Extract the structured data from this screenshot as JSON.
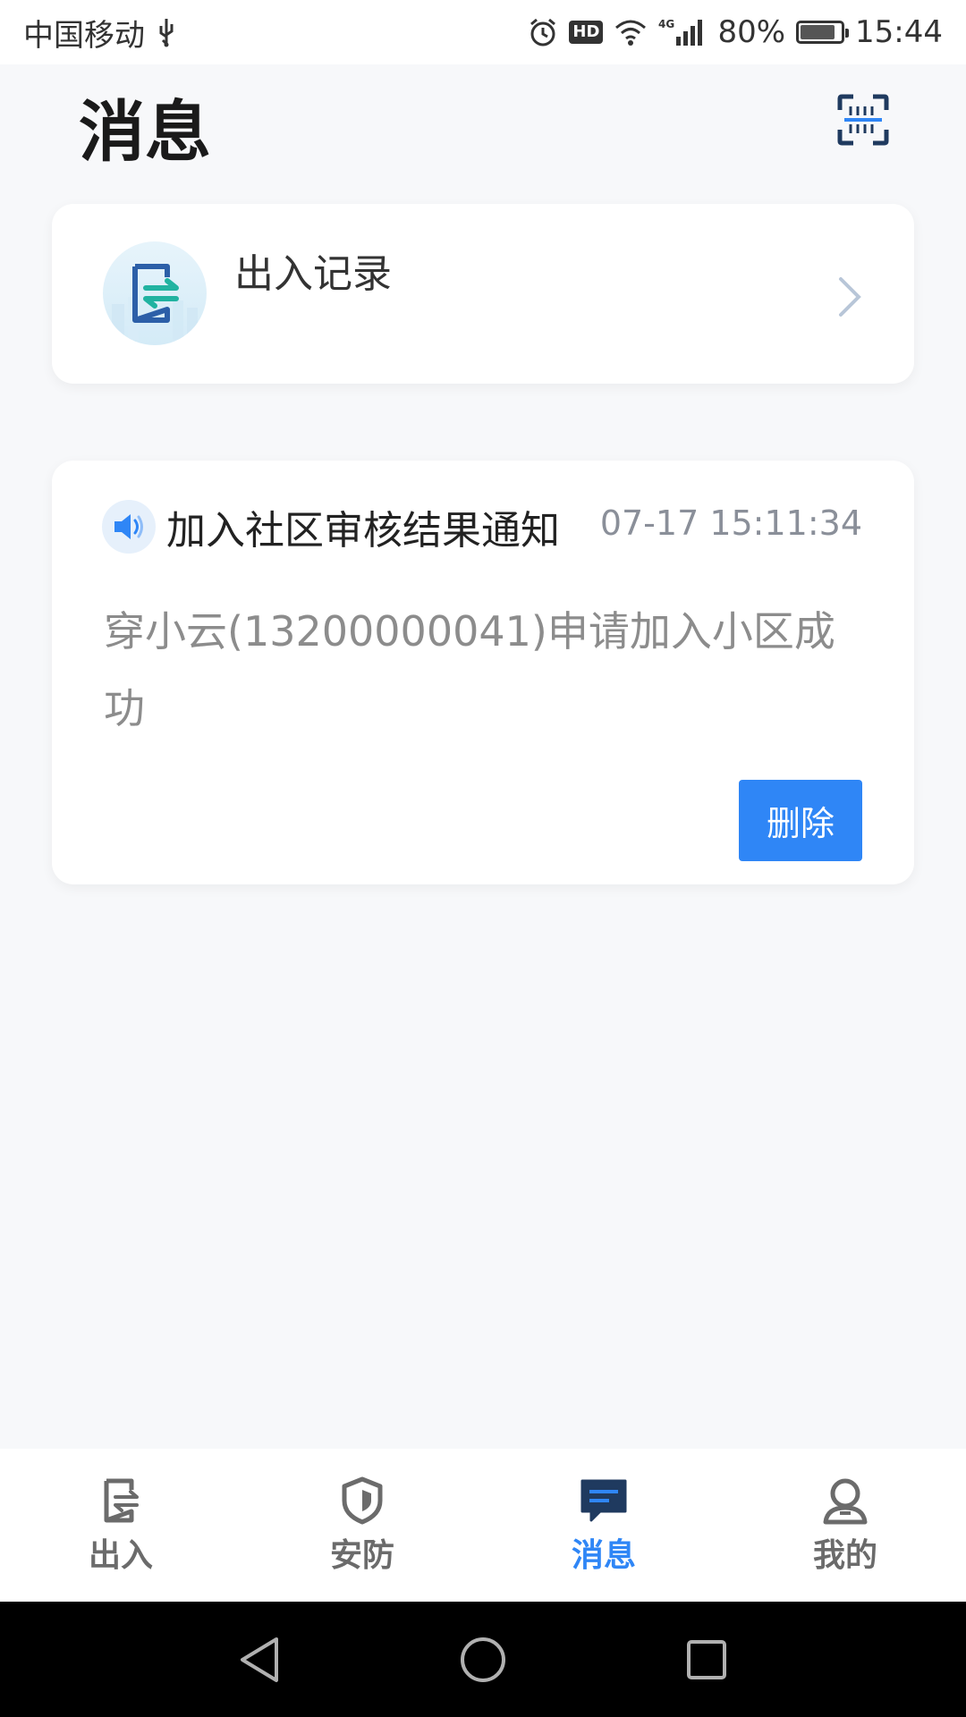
{
  "status_bar": {
    "carrier": "中国移动",
    "hd": "HD",
    "network": "4G",
    "battery": "80%",
    "time": "15:44"
  },
  "header": {
    "title": "消息",
    "scan_icon": "scan-icon"
  },
  "entry_record": {
    "label": "出入记录",
    "icon": "entry-exit-icon"
  },
  "notice": {
    "title": "加入社区审核结果通知",
    "time": "07-17 15:11:34",
    "body": "穿小云(13200000041)申请加入小区成功",
    "delete_label": "删除",
    "icon": "speaker-icon"
  },
  "tabs": [
    {
      "label": "出入",
      "icon": "entry-icon",
      "active": false
    },
    {
      "label": "安防",
      "icon": "shield-icon",
      "active": false
    },
    {
      "label": "消息",
      "icon": "message-icon",
      "active": true
    },
    {
      "label": "我的",
      "icon": "user-icon",
      "active": false
    }
  ],
  "colors": {
    "accent": "#2f86f6",
    "background": "#f7f8fa",
    "inactive": "#6b6b6b"
  }
}
